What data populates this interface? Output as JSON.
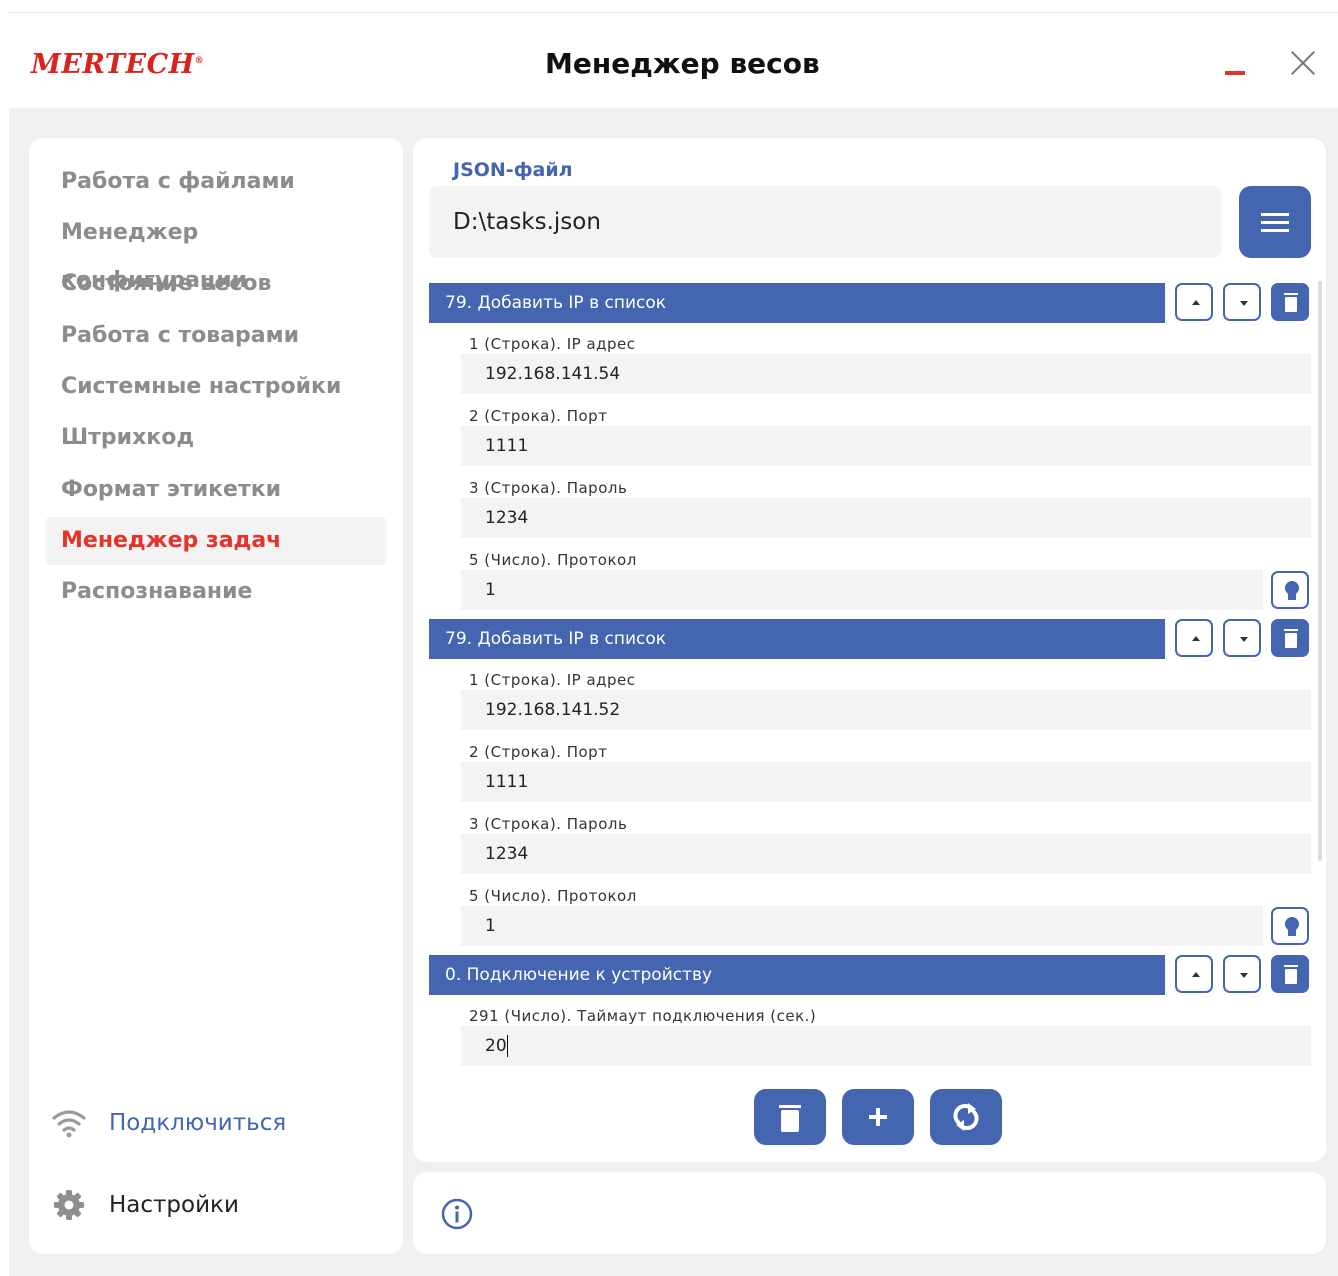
{
  "header": {
    "logo_text": "MERTECH",
    "logo_reg": "®",
    "title": "Менеджер весов",
    "minimize_icon": "minimize-icon",
    "close_icon": "close-icon"
  },
  "sidebar": {
    "items": [
      {
        "label": "Работа с файлами",
        "active": false
      },
      {
        "label": "Менеджер конфигурации",
        "active": false
      },
      {
        "label": "Состояние весов",
        "active": false
      },
      {
        "label": "Работа с товарами",
        "active": false
      },
      {
        "label": "Системные настройки",
        "active": false
      },
      {
        "label": "Штрихкод",
        "active": false
      },
      {
        "label": "Формат этикетки",
        "active": false
      },
      {
        "label": "Менеджер задач",
        "active": true
      },
      {
        "label": "Распознавание",
        "active": false
      }
    ],
    "connect_label": "Подключиться",
    "settings_label": "Настройки"
  },
  "main": {
    "file_label": "JSON-файл",
    "file_path": "D:\\tasks.json",
    "tasks": [
      {
        "title": "79. Добавить IP в список",
        "params": [
          {
            "label": "1 (Строка). IP адрес",
            "value": "192.168.141.54"
          },
          {
            "label": "2 (Строка). Порт",
            "value": "1111"
          },
          {
            "label": "3 (Строка). Пароль",
            "value": "1234"
          },
          {
            "label": "5 (Число). Протокол",
            "value": "1"
          }
        ]
      },
      {
        "title": "79. Добавить IP в список",
        "params": [
          {
            "label": "1 (Строка). IP адрес",
            "value": "192.168.141.52"
          },
          {
            "label": "2 (Строка). Порт",
            "value": "1111"
          },
          {
            "label": "3 (Строка). Пароль",
            "value": "1234"
          },
          {
            "label": "5 (Число). Протокол",
            "value": "1"
          }
        ]
      },
      {
        "title": "0. Подключение к устройству",
        "params": [
          {
            "label": "291 (Число). Таймаут подключения (сек.)",
            "value": "20"
          }
        ]
      }
    ]
  },
  "colors": {
    "accent": "#4466b0",
    "brand_red": "#e5332a",
    "panel": "#ffffff",
    "background": "#f0f0f0"
  }
}
